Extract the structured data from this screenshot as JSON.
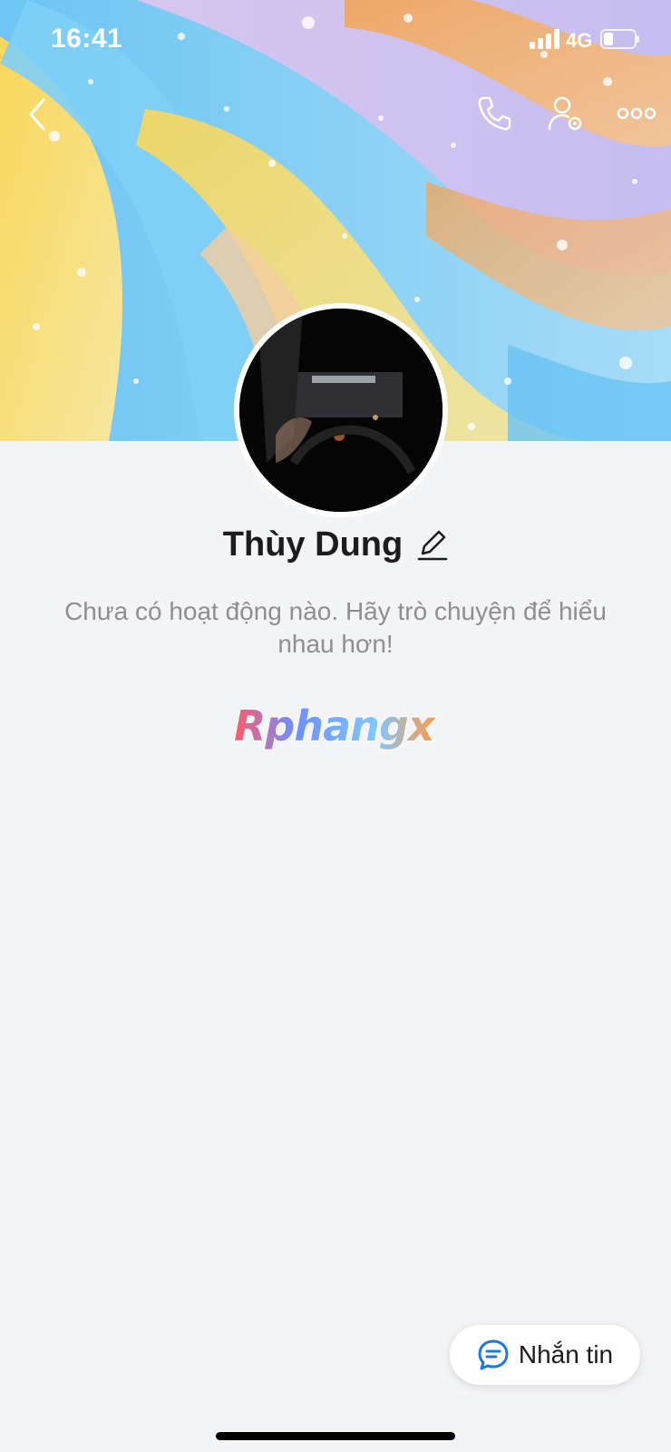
{
  "status_bar": {
    "time": "16:41",
    "network": "4G"
  },
  "icons": {
    "back": "chevron-left-icon",
    "call": "phone-icon",
    "settings": "user-settings-icon",
    "more": "more-dots-icon",
    "edit": "pencil-icon",
    "message": "chat-bubble-icon"
  },
  "profile": {
    "name": "Thùy Dung",
    "empty_activity": "Chưa có hoạt động nào. Hãy trò chuyện để hiểu nhau hơn!"
  },
  "watermark": {
    "text": "Rphangx"
  },
  "actions": {
    "message_label": "Nhắn tin"
  },
  "colors": {
    "accent": "#1f7ae0",
    "background": "#f3f4f6"
  }
}
